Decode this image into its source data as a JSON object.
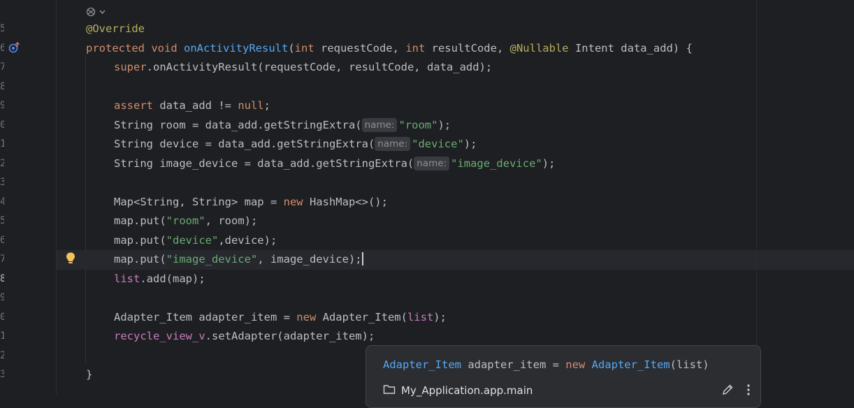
{
  "editor": {
    "line_numbers": [
      "5",
      "6",
      "7",
      "8",
      "9",
      "0",
      "1",
      "2",
      "3",
      "4",
      "5",
      "6",
      "7",
      "8",
      "9",
      "0",
      "1",
      "2",
      "3"
    ],
    "active_line": 13,
    "lines": [
      {
        "indent": 0,
        "tokens": [
          {
            "c": "an",
            "t": "@Override"
          }
        ]
      },
      {
        "indent": 0,
        "tokens": [
          {
            "c": "kw",
            "t": "protected "
          },
          {
            "c": "kw",
            "t": "void "
          },
          {
            "c": "fn",
            "t": "onActivityResult"
          },
          {
            "c": "pl",
            "t": "("
          },
          {
            "c": "kw",
            "t": "int "
          },
          {
            "c": "pl",
            "t": "requestCode, "
          },
          {
            "c": "kw",
            "t": "int "
          },
          {
            "c": "pl",
            "t": "resultCode, "
          },
          {
            "c": "an",
            "t": "@Nullable "
          },
          {
            "c": "pl",
            "t": "Intent data_add) {"
          }
        ]
      },
      {
        "indent": 1,
        "tokens": [
          {
            "c": "kw",
            "t": "super"
          },
          {
            "c": "pl",
            "t": ".onActivityResult(requestCode, resultCode, data_add);"
          }
        ]
      },
      {
        "indent": 1,
        "tokens": []
      },
      {
        "indent": 1,
        "tokens": [
          {
            "c": "kw",
            "t": "assert "
          },
          {
            "c": "pl",
            "t": "data_add != "
          },
          {
            "c": "kw",
            "t": "null"
          },
          {
            "c": "pl",
            "t": ";"
          }
        ]
      },
      {
        "indent": 1,
        "tokens": [
          {
            "c": "pl",
            "t": "String room = data_add.getStringExtra("
          },
          {
            "c": "hint",
            "t": "name:"
          },
          {
            "c": "st",
            "t": "\"room\""
          },
          {
            "c": "pl",
            "t": ");"
          }
        ]
      },
      {
        "indent": 1,
        "tokens": [
          {
            "c": "pl",
            "t": "String device = data_add.getStringExtra("
          },
          {
            "c": "hint",
            "t": "name:"
          },
          {
            "c": "st",
            "t": "\"device\""
          },
          {
            "c": "pl",
            "t": ");"
          }
        ]
      },
      {
        "indent": 1,
        "tokens": [
          {
            "c": "pl",
            "t": "String image_device = data_add.getStringExtra("
          },
          {
            "c": "hint",
            "t": "name:"
          },
          {
            "c": "st",
            "t": "\"image_device\""
          },
          {
            "c": "pl",
            "t": ");"
          }
        ]
      },
      {
        "indent": 1,
        "tokens": []
      },
      {
        "indent": 1,
        "tokens": [
          {
            "c": "pl",
            "t": "Map<String, String> map = "
          },
          {
            "c": "kw",
            "t": "new "
          },
          {
            "c": "pl",
            "t": "HashMap<>();"
          }
        ]
      },
      {
        "indent": 1,
        "tokens": [
          {
            "c": "pl",
            "t": "map.put("
          },
          {
            "c": "st",
            "t": "\"room\""
          },
          {
            "c": "pl",
            "t": ", room);"
          }
        ]
      },
      {
        "indent": 1,
        "tokens": [
          {
            "c": "pl",
            "t": "map.put("
          },
          {
            "c": "st",
            "t": "\"device\""
          },
          {
            "c": "pl",
            "t": ",device);"
          }
        ]
      },
      {
        "indent": 1,
        "tokens": [
          {
            "c": "pl",
            "t": "map.put("
          },
          {
            "c": "st",
            "t": "\"image_device\""
          },
          {
            "c": "pl",
            "t": ", image_device);"
          }
        ],
        "caret": true
      },
      {
        "indent": 1,
        "tokens": [
          {
            "c": "fd",
            "t": "list"
          },
          {
            "c": "pl",
            "t": ".add(map);"
          }
        ]
      },
      {
        "indent": 1,
        "tokens": []
      },
      {
        "indent": 1,
        "tokens": [
          {
            "c": "pl",
            "t": "Adapter_Item adapter_item = "
          },
          {
            "c": "kw",
            "t": "new "
          },
          {
            "c": "pl",
            "t": "Adapter_Item("
          },
          {
            "c": "fd",
            "t": "list"
          },
          {
            "c": "pl",
            "t": ");"
          }
        ]
      },
      {
        "indent": 1,
        "tokens": [
          {
            "c": "fd",
            "t": "recycle_view_v"
          },
          {
            "c": "pl",
            "t": ".setAdapter(adapter_item);"
          }
        ]
      },
      {
        "indent": 1,
        "tokens": []
      },
      {
        "indent": 0,
        "tokens": [
          {
            "c": "pl",
            "t": "}"
          }
        ]
      }
    ]
  },
  "popup": {
    "sig_type": "Adapter_Item",
    "sig_var": " adapter_item = ",
    "sig_new": "new",
    "sig_ctor": "Adapter_Item",
    "sig_args": "(list)",
    "location": "My_Application.app.main"
  },
  "icons": {
    "code_vision": "code-vision-icon",
    "override_marker": "override-marker-icon",
    "intention_bulb": "bulb-icon",
    "folder": "folder-icon",
    "edit": "pencil-icon",
    "more": "kebab-icon"
  }
}
